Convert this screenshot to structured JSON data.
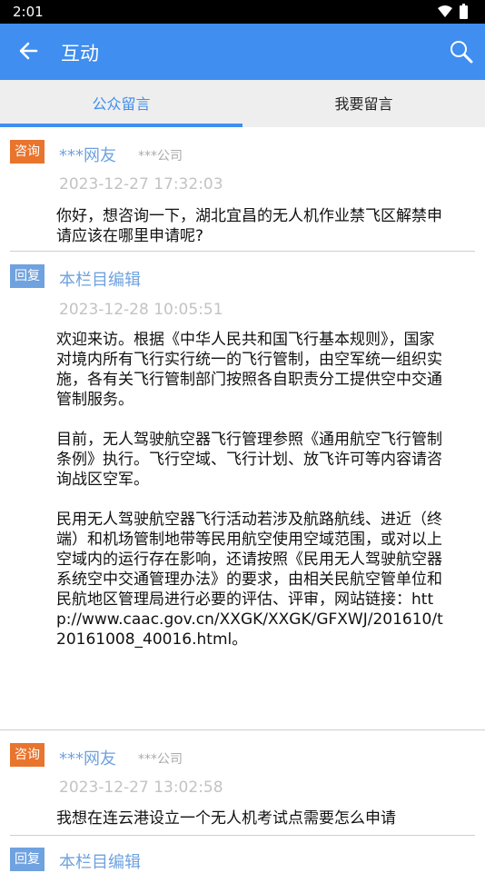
{
  "status": {
    "time": "2:01"
  },
  "appbar": {
    "title": "互动"
  },
  "tabs": [
    {
      "label": "公众留言",
      "active": true
    },
    {
      "label": "我要留言",
      "active": false
    }
  ],
  "entries": [
    {
      "badge": "咨询",
      "author": "***网友",
      "company": "***公司",
      "time": "2023-12-27 17:32:03",
      "content": "你好，想咨询一下，湖北宜昌的无人机作业禁飞区解禁申请应该在哪里申请呢?"
    },
    {
      "badge": "回复",
      "author": "本栏目编辑",
      "time": "2023-12-28 10:05:51",
      "content": "欢迎来访。根据《中华人民共和国飞行基本规则》，国家对境内所有飞行实行统一的飞行管制，由空军统一组织实施，各有关飞行管制部门按照各自职责分工提供空中交通管制服务。\n\n目前，无人驾驶航空器飞行管理参照《通用航空飞行管制条例》执行。飞行空域、飞行计划、放飞许可等内容请咨询战区空军。\n\n民用无人驾驶航空器飞行活动若涉及航路航线、进近（终端）和机场管制地带等民用航空使用空域范围，或对以上空域内的运行存在影响，还请按照《民用无人驾驶航空器系统空中交通管理办法》的要求，由相关民航空管单位和民航地区管理局进行必要的评估、评审，网站链接：http://www.caac.gov.cn/XXGK/XXGK/GFXWJ/201610/t20161008_40016.html。"
    },
    {
      "badge": "咨询",
      "author": "***网友",
      "company": "***公司",
      "time": "2023-12-27 13:02:58",
      "content": "我想在连云港设立一个无人机考试点需要怎么申请"
    },
    {
      "badge": "回复",
      "author": "本栏目编辑"
    }
  ]
}
